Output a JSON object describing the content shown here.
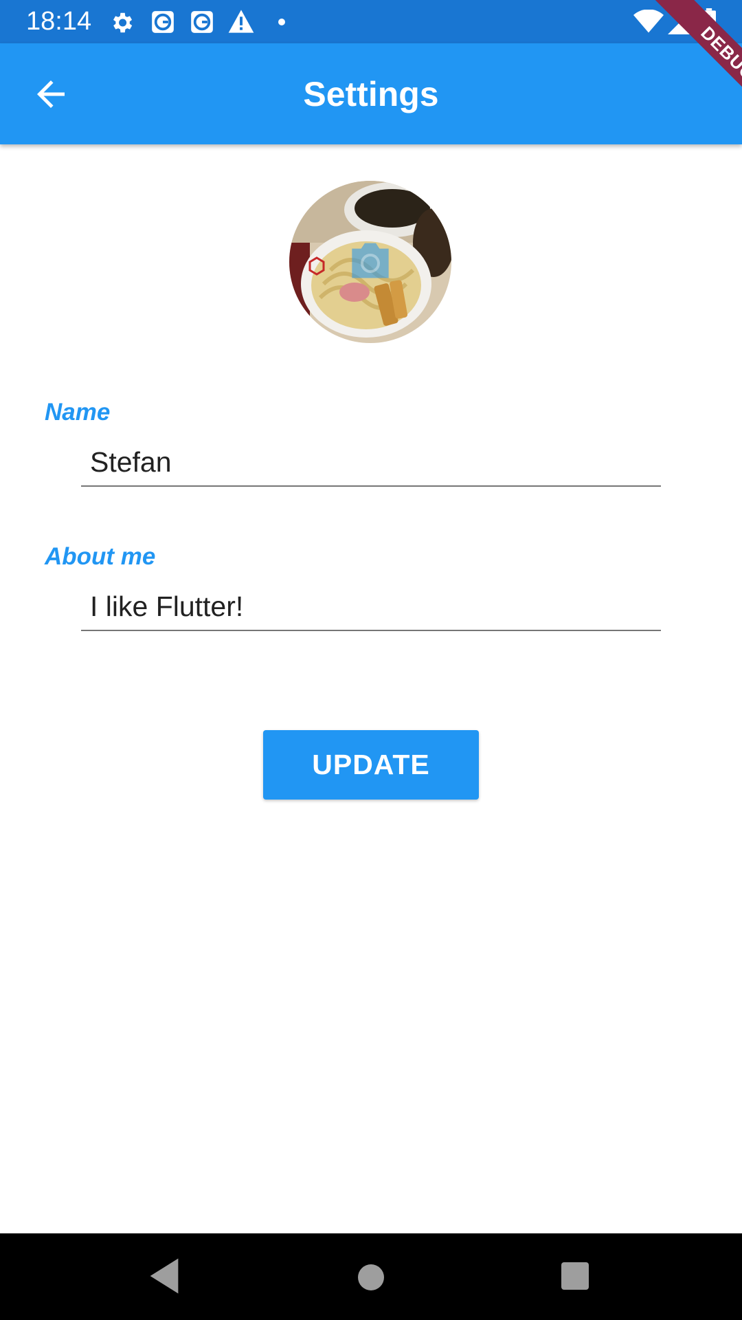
{
  "status_bar": {
    "time": "18:14",
    "left_icons": [
      "gear-icon",
      "g-app-icon",
      "g-app-icon",
      "warning-icon",
      "dot-icon"
    ],
    "right_icons": [
      "wifi-icon",
      "cellular-icon",
      "battery-charging-icon"
    ],
    "background": "#1976d2"
  },
  "debug_banner": {
    "label": "DEBUG",
    "color": "#8a2748"
  },
  "app_bar": {
    "title": "Settings",
    "back_icon": "arrow-back-icon",
    "background": "#2196f3"
  },
  "profile": {
    "avatar_icon": "camera-icon"
  },
  "form": {
    "name": {
      "label": "Name",
      "value": "Stefan"
    },
    "about": {
      "label": "About me",
      "value": "I like Flutter!"
    },
    "accent_color": "#2196f3"
  },
  "actions": {
    "update_label": "UPDATE"
  },
  "nav_bar": {
    "icons": [
      "back-triangle-icon",
      "home-circle-icon",
      "recents-square-icon"
    ]
  }
}
